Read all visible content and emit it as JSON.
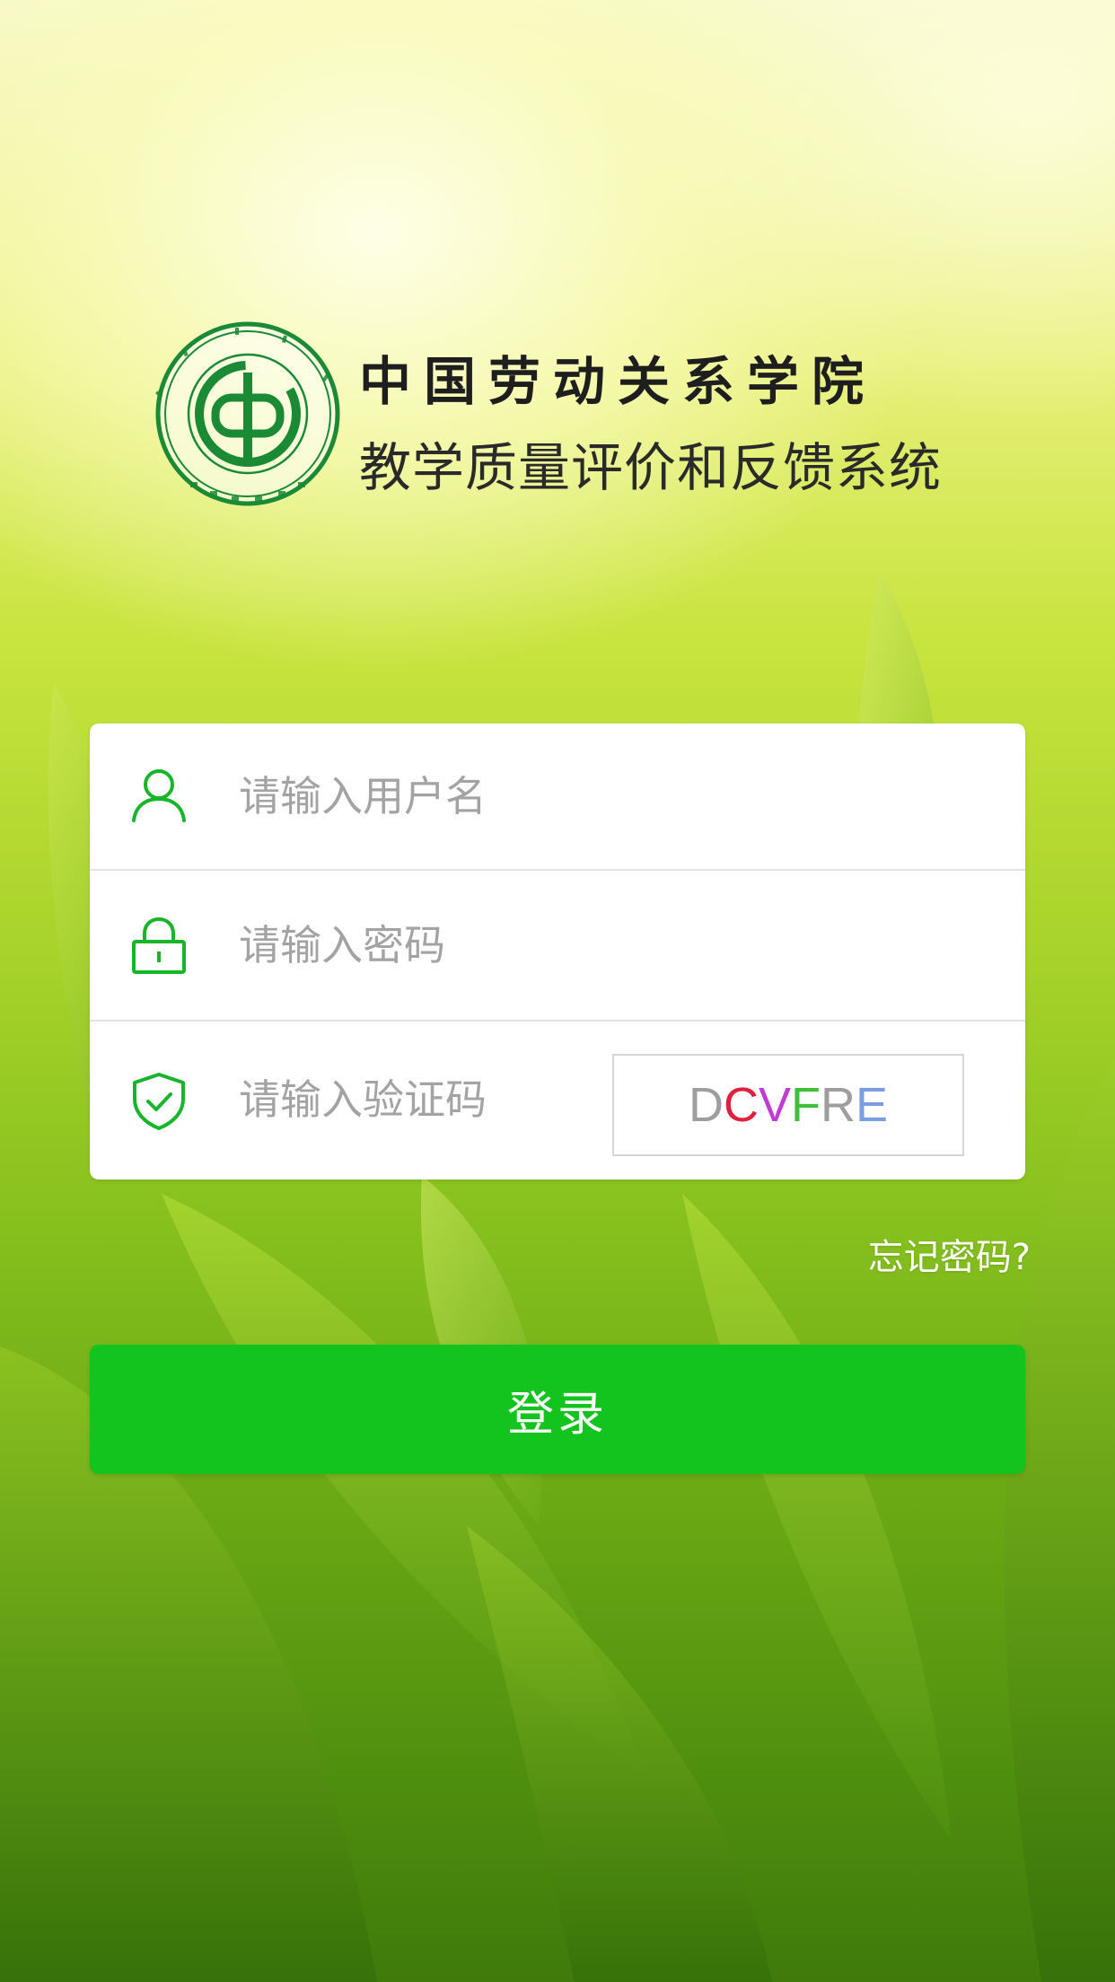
{
  "branding": {
    "school_name": "中国劳动关系学院",
    "system_name": "教学质量评价和反馈系统",
    "seal_icon": "school-seal-logo",
    "seal_color": "#1a8a35"
  },
  "login_form": {
    "username": {
      "placeholder": "请输入用户名",
      "value": "",
      "icon": "user-icon"
    },
    "password": {
      "placeholder": "请输入密码",
      "value": "",
      "icon": "lock-icon"
    },
    "captcha": {
      "placeholder": "请输入验证码",
      "value": "",
      "icon": "shield-check-icon",
      "code_chars": [
        {
          "char": "D",
          "color": "#9e9e9e"
        },
        {
          "char": "C",
          "color": "#e0203c"
        },
        {
          "char": "V",
          "color": "#c23bd6"
        },
        {
          "char": "F",
          "color": "#3fbf3a"
        },
        {
          "char": "R",
          "color": "#9e9e9e"
        },
        {
          "char": "E",
          "color": "#7a9ee0"
        }
      ]
    },
    "forgot_password_label": "忘记密码?",
    "submit_label": "登录"
  },
  "colors": {
    "accent_green": "#13c31e",
    "icon_green": "#18b52a",
    "placeholder_gray": "#a3a3a3"
  }
}
